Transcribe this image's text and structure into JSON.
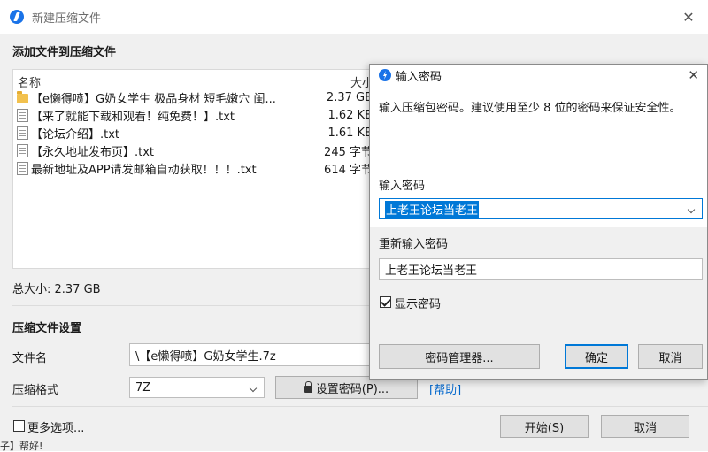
{
  "main_window": {
    "title": "新建压缩文件",
    "close_glyph": "✕",
    "add_files_heading": "添加文件到压缩文件",
    "columns": {
      "name": "名称",
      "size": "大小"
    },
    "files": [
      {
        "icon": "folder-icon",
        "name": "【e懒得喷】G奶女学生 极品身材 短毛嫩穴  闺...",
        "size": "2.37 GB"
      },
      {
        "icon": "text-file-icon",
        "name": "【来了就能下载和观看！纯免费！】.txt",
        "size": "1.62 KB"
      },
      {
        "icon": "text-file-icon",
        "name": "【论坛介绍】.txt",
        "size": "1.61 KB"
      },
      {
        "icon": "text-file-icon",
        "name": "【永久地址发布页】.txt",
        "size": "245 字节"
      },
      {
        "icon": "text-file-icon",
        "name": "最新地址及APP请发邮箱自动获取！！！.txt",
        "size": "614 字节"
      }
    ],
    "total_size": "总大小: 2.37 GB",
    "settings_heading": "压缩文件设置",
    "filename_label": "文件名",
    "filename_value": "\\【e懒得喷】G奶女学生.7z",
    "format_label": "压缩格式",
    "format_value": "7Z",
    "set_password_button": "设置密码(P)...",
    "help_link": "[帮助]",
    "more_options_label": "更多选项...",
    "start_button": "开始(S)",
    "cancel_button": "取消",
    "bottom_cut_text": "子】帮好!"
  },
  "password_dialog": {
    "title": "输入密码",
    "close_glyph": "✕",
    "description": "输入压缩包密码。建议使用至少 8 位的密码来保证安全性。",
    "password_label": "输入密码",
    "password_value": "上老王论坛当老王",
    "confirm_label": "重新输入密码",
    "confirm_value": "上老王论坛当老王",
    "show_password_label": "显示密码",
    "show_password_checked": true,
    "manager_button": "密码管理器...",
    "ok_button": "确定",
    "cancel_button": "取消"
  },
  "colors": {
    "accent": "#1a73e8",
    "link": "#0066cc",
    "selection": "#0078d7"
  }
}
